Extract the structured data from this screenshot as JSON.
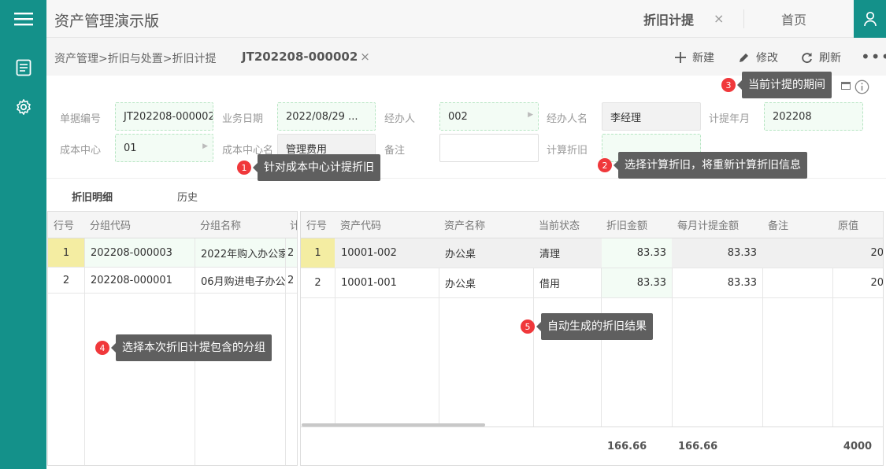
{
  "app": {
    "title": "资产管理演示版"
  },
  "tabs": [
    {
      "label": "折旧计提",
      "active": true
    },
    {
      "label": "首页",
      "active": false
    }
  ],
  "breadcrumb": "资产管理>折旧与处置>折旧计提",
  "doc_tag": "JT202208-000002",
  "toolbar": {
    "new_label": "新建",
    "edit_label": "修改",
    "refresh_label": "刷新"
  },
  "form": {
    "doc_no": {
      "label": "单据编号",
      "value": "JT202208-000002"
    },
    "biz_date": {
      "label": "业务日期",
      "value": "2022/08/29 ..."
    },
    "handler": {
      "label": "经办人",
      "value": "002"
    },
    "handler_name": {
      "label": "经办人名",
      "value": "李经理"
    },
    "period": {
      "label": "计提年月",
      "value": "202208"
    },
    "cost_center": {
      "label": "成本中心",
      "value": "01"
    },
    "cost_center_name": {
      "label": "成本中心名",
      "value": "管理费用"
    },
    "remark": {
      "label": "备注",
      "value": ""
    },
    "recalc": {
      "label": "计算折旧",
      "value": ""
    }
  },
  "subtabs": [
    {
      "label": "折旧明细",
      "active": true
    },
    {
      "label": "历史",
      "active": false
    }
  ],
  "left_grid": {
    "headers": [
      "行号",
      "分组代码",
      "分组名称",
      "计"
    ],
    "rows": [
      {
        "rn": "1",
        "code": "202208-000003",
        "name": "2022年购入办公家",
        "extra": "2"
      },
      {
        "rn": "2",
        "code": "202208-000001",
        "name": "06月购进电子办公",
        "extra": "2"
      }
    ]
  },
  "right_grid": {
    "headers": [
      "行号",
      "资产代码",
      "资产名称",
      "当前状态",
      "折旧金额",
      "每月计提金额",
      "备注",
      "原值"
    ],
    "rows": [
      {
        "rn": "1",
        "code": "10001-002",
        "name": "办公桌",
        "status": "清理",
        "dep": "83.33",
        "monthly": "83.33",
        "remark": "",
        "orig": "20"
      },
      {
        "rn": "2",
        "code": "10001-001",
        "name": "办公桌",
        "status": "借用",
        "dep": "83.33",
        "monthly": "83.33",
        "remark": "",
        "orig": "20"
      }
    ],
    "totals": {
      "dep": "166.66",
      "monthly": "166.66",
      "orig": "4000"
    }
  },
  "hints": [
    {
      "n": "1",
      "text": "针对成本中心计提折旧"
    },
    {
      "n": "2",
      "text": "选择计算折旧，将重新计算折旧信息"
    },
    {
      "n": "3",
      "text": "当前计提的期间"
    },
    {
      "n": "4",
      "text": "选择本次折旧计提包含的分组"
    },
    {
      "n": "5",
      "text": "自动生成的折旧结果"
    }
  ],
  "colors": {
    "brand": "#14918a",
    "badge": "#f0383b",
    "tooltip": "#5f5f5f"
  }
}
